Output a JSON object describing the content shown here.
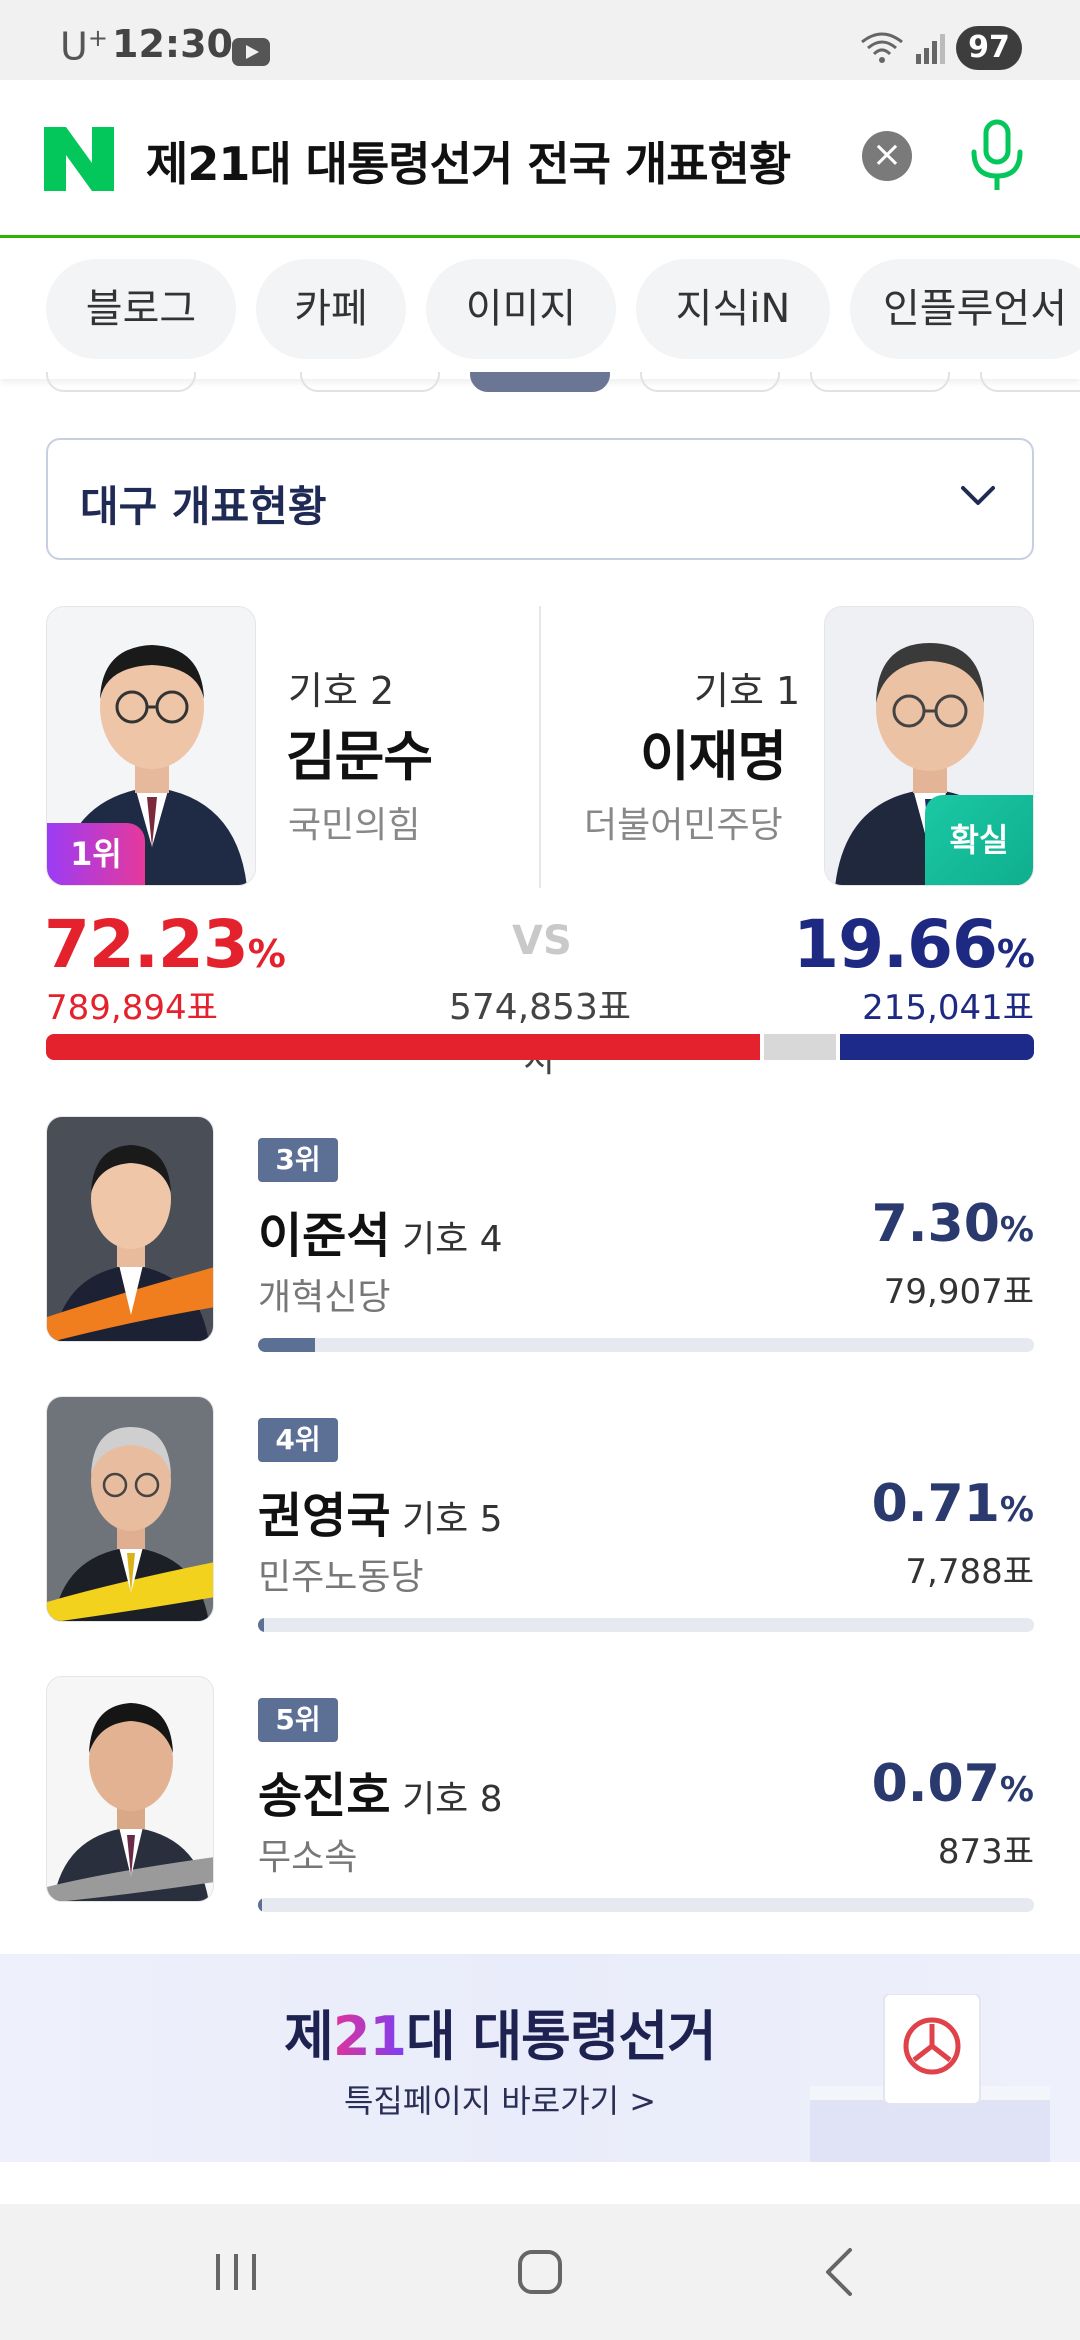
{
  "status_bar": {
    "carrier": "U",
    "carrier_sup": "+",
    "time": "12:30",
    "battery": "97",
    "icons": [
      "youtube-icon",
      "wifi-icon",
      "signal-icon",
      "battery-icon"
    ]
  },
  "search": {
    "query": "제21대 대통령선거 전국 개표현황",
    "clear_symbol": "×",
    "brand_color": "#03c75a"
  },
  "tabs": [
    "블로그",
    "카페",
    "이미지",
    "지식iN",
    "인플루언서"
  ],
  "region": {
    "label": "대구 개표현황"
  },
  "leaders": {
    "left": {
      "number_label": "기호 2",
      "name": "김문수",
      "party": "국민의힘",
      "rank_badge": "1위",
      "percent": "72.23",
      "percent_unit": "%",
      "votes": "789,894표",
      "color": "#e3222d",
      "share": 0.7223
    },
    "right": {
      "number_label": "기호 1",
      "name": "이재명",
      "party": "더불어민주당",
      "status_badge": "확실",
      "percent": "19.66",
      "percent_unit": "%",
      "votes": "215,041표",
      "color": "#1e2a82",
      "share": 0.1966
    },
    "vs_label": "VS",
    "gap_label": "574,853표차"
  },
  "others": [
    {
      "rank": "3위",
      "name": "이준석",
      "number_label": "기호 4",
      "party": "개혁신당",
      "percent": "7.30",
      "percent_unit": "%",
      "votes": "79,907표",
      "share": 0.073
    },
    {
      "rank": "4위",
      "name": "권영국",
      "number_label": "기호 5",
      "party": "민주노동당",
      "percent": "0.71",
      "percent_unit": "%",
      "votes": "7,788표",
      "share": 0.0071
    },
    {
      "rank": "5위",
      "name": "송진호",
      "number_label": "기호 8",
      "party": "무소속",
      "percent": "0.07",
      "percent_unit": "%",
      "votes": "873표",
      "share": 0.0007
    }
  ],
  "banner": {
    "title_pre": "제",
    "title_num": "21",
    "title_post": "대 대통령선거",
    "link": "특집페이지 바로가기 >"
  }
}
